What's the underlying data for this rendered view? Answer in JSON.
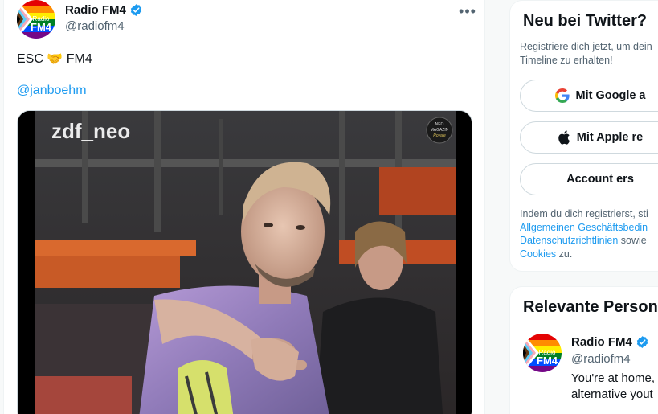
{
  "tweet": {
    "author_name": "Radio FM4",
    "author_handle": "@radiofm4",
    "more_icon": "more-dots-icon",
    "text_prefix": "ESC",
    "text_emoji": "🤝",
    "text_suffix": "FM4",
    "mention": "@janboehm",
    "media": {
      "type": "video-still",
      "watermark": "zdf_neo",
      "corner_logo_line1": "NEO",
      "corner_logo_line2": "MAGAZIN",
      "corner_logo_line3": "Royale"
    }
  },
  "sidebar": {
    "signup": {
      "title": "Neu bei Twitter?",
      "subtitle_line1": "Registriere dich jetzt, um dein",
      "subtitle_line2": "Timeline zu erhalten!",
      "google_label": "Mit Google a",
      "apple_label": "Mit Apple re",
      "account_label": "Account ers",
      "legal_line1": "Indem du dich registrierst, sti",
      "legal_link1": "Allgemeinen Geschäftsbedin",
      "legal_link2": "Datenschutzrichtlinien",
      "legal_mid": " sowie",
      "legal_link3": "Cookies",
      "legal_end": " zu."
    },
    "people": {
      "title": "Relevante Person",
      "person_name": "Radio FM4",
      "person_handle": "@radiofm4",
      "bio_line1": "You're at home,",
      "bio_line2": "alternative yout"
    }
  },
  "avatar": {
    "logo_small": "Radio",
    "logo_big": "FM4"
  },
  "colors": {
    "accent": "#1d9bf0",
    "verified": "#1d9bf0",
    "text_secondary": "#536471"
  }
}
